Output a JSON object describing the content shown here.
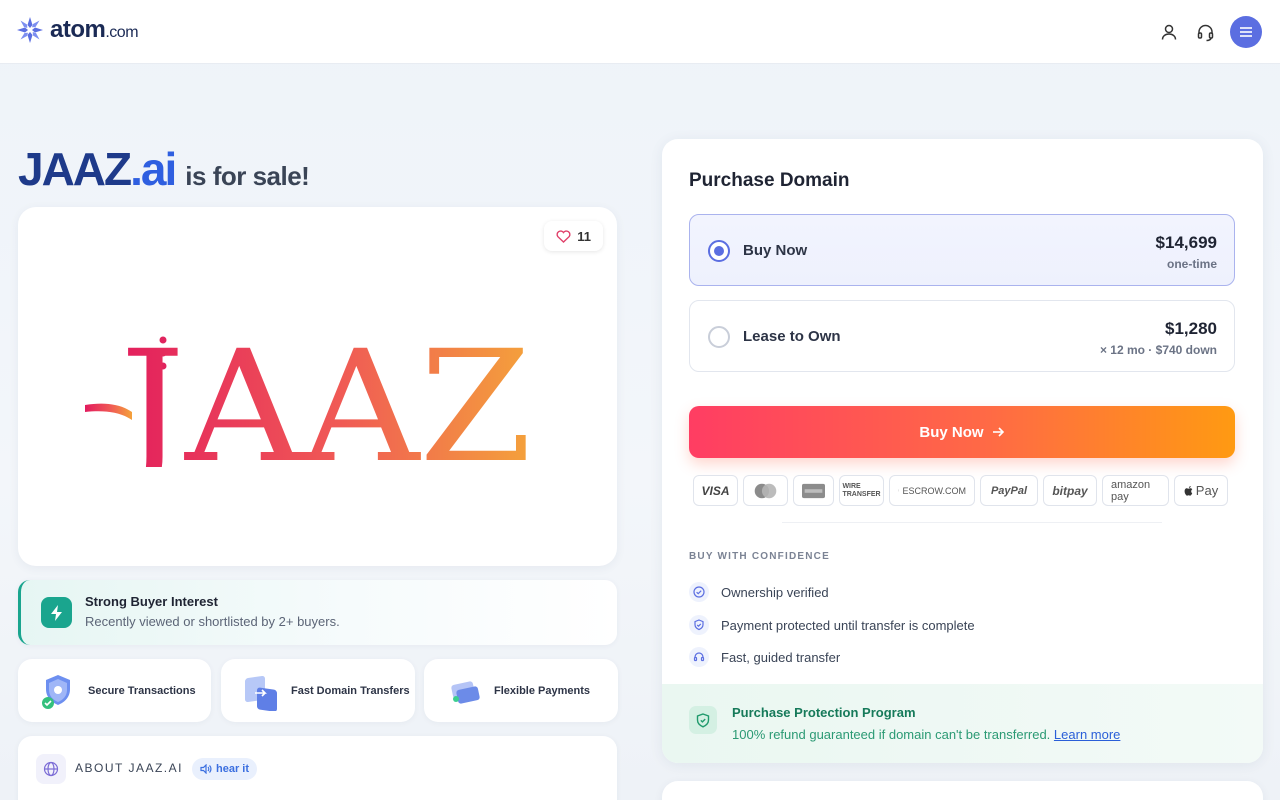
{
  "header": {
    "logo_name": "atom",
    "logo_suffix": ".com",
    "icons": [
      "user-icon",
      "headset-icon",
      "menu-icon"
    ]
  },
  "hero": {
    "domain": "JAAZ",
    "tld": ".ai",
    "for_sale": "is for sale!"
  },
  "logo_card": {
    "likes": "11",
    "brand_text": "JAAZ"
  },
  "interest": {
    "title": "Strong Buyer Interest",
    "subtitle": "Recently viewed or shortlisted by 2+ buyers."
  },
  "features": [
    {
      "label": "Secure Transactions",
      "icon": "shield-check-icon"
    },
    {
      "label": "Fast Domain Transfers",
      "icon": "transfer-icon"
    },
    {
      "label": "Flexible Payments",
      "icon": "cards-icon"
    }
  ],
  "about": {
    "title": "ABOUT JAAZ.AI",
    "hear_label": "hear it"
  },
  "purchase": {
    "title": "Purchase Domain",
    "options": [
      {
        "label": "Buy Now",
        "price": "$14,699",
        "sub": "one-time",
        "selected": true
      },
      {
        "label": "Lease to Own",
        "price": "$1,280",
        "sub": "× 12 mo · $740 down",
        "selected": false
      }
    ],
    "buy_button": "Buy Now",
    "payment_methods": [
      "VISA",
      "MasterCard",
      "Amex",
      "WIRE TRANSFER",
      "ESCROW.COM",
      "PayPal",
      "bitpay",
      "amazon pay",
      "Pay"
    ],
    "confidence_title": "BUY WITH CONFIDENCE",
    "confidence_items": [
      "Ownership verified",
      "Payment protected until transfer is complete",
      "Fast, guided transfer"
    ],
    "protection": {
      "title": "Purchase Protection Program",
      "text": "100% refund guaranteed if domain can't be transferred.",
      "link": "Learn more"
    }
  },
  "colors": {
    "accent": "#5b6ee1",
    "cta_start": "#ff3d63",
    "cta_end": "#ff9a12",
    "success": "#19a58e",
    "domain_blue": "#1e3a8a"
  }
}
